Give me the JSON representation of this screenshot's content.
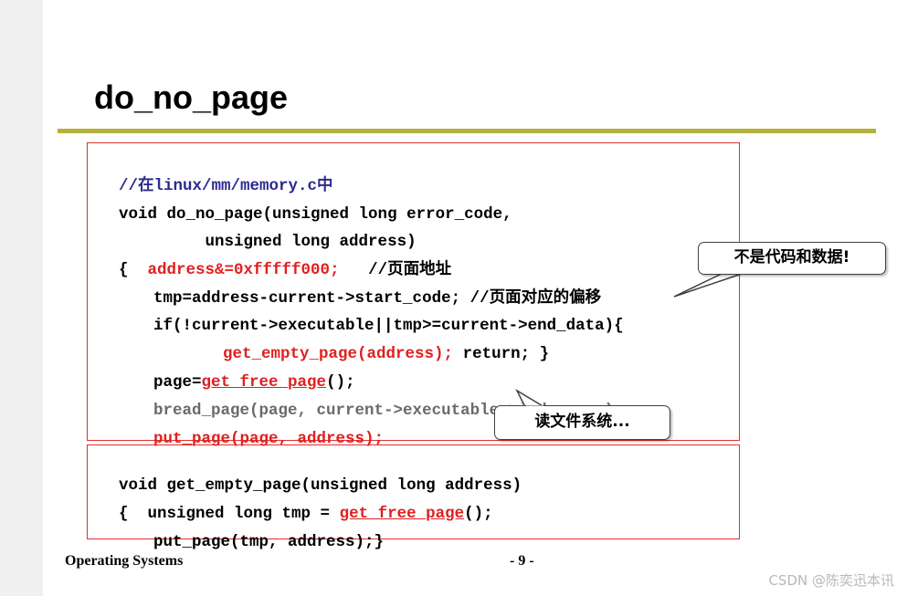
{
  "slide": {
    "title": "do_no_page"
  },
  "code_block_1": {
    "lines": [
      {
        "seg1": "//在linux/mm/memory.c中"
      },
      {
        "seg1": "void do_no_page(unsigned long error_code,"
      },
      {
        "seg1": "         unsigned long address)"
      },
      {
        "seg1": "{  ",
        "seg2": "address&=0xfffff000;",
        "seg3": "   //页面地址"
      },
      {
        "seg1": "tmp=address-current->start_code; //页面对应的偏移"
      },
      {
        "seg1": "if(!current->executable||tmp>=current->end_data){"
      },
      {
        "seg1": "get_empty_page(address);",
        "seg2": " return; }"
      },
      {
        "seg1": "page=",
        "seg2": "get_free_page",
        "seg3": "();"
      },
      {
        "seg1": "bread_page(page, current->executable->i_dev, nr);"
      },
      {
        "seg1": "put_page(page, address);"
      }
    ]
  },
  "code_block_2": {
    "lines": [
      {
        "seg1": "void get_empty_page(unsigned long address)"
      },
      {
        "seg1": "{  unsigned long tmp = ",
        "seg2": "get_free_page",
        "seg3": "();"
      },
      {
        "seg1": "put_page(tmp, address);}"
      }
    ]
  },
  "callouts": {
    "not_code_data": "不是代码和数据!",
    "read_fs": "读文件系统..."
  },
  "footer": {
    "course": "Operating Systems",
    "page": "- 9 -"
  },
  "watermark": "CSDN @陈奕迅本讯",
  "colors": {
    "title_rule": "#b5b23f",
    "box_border": "#e03030",
    "comment_blue": "#2b2b90",
    "highlight_red": "#e02020",
    "dim_gray": "#6a6a6a"
  }
}
